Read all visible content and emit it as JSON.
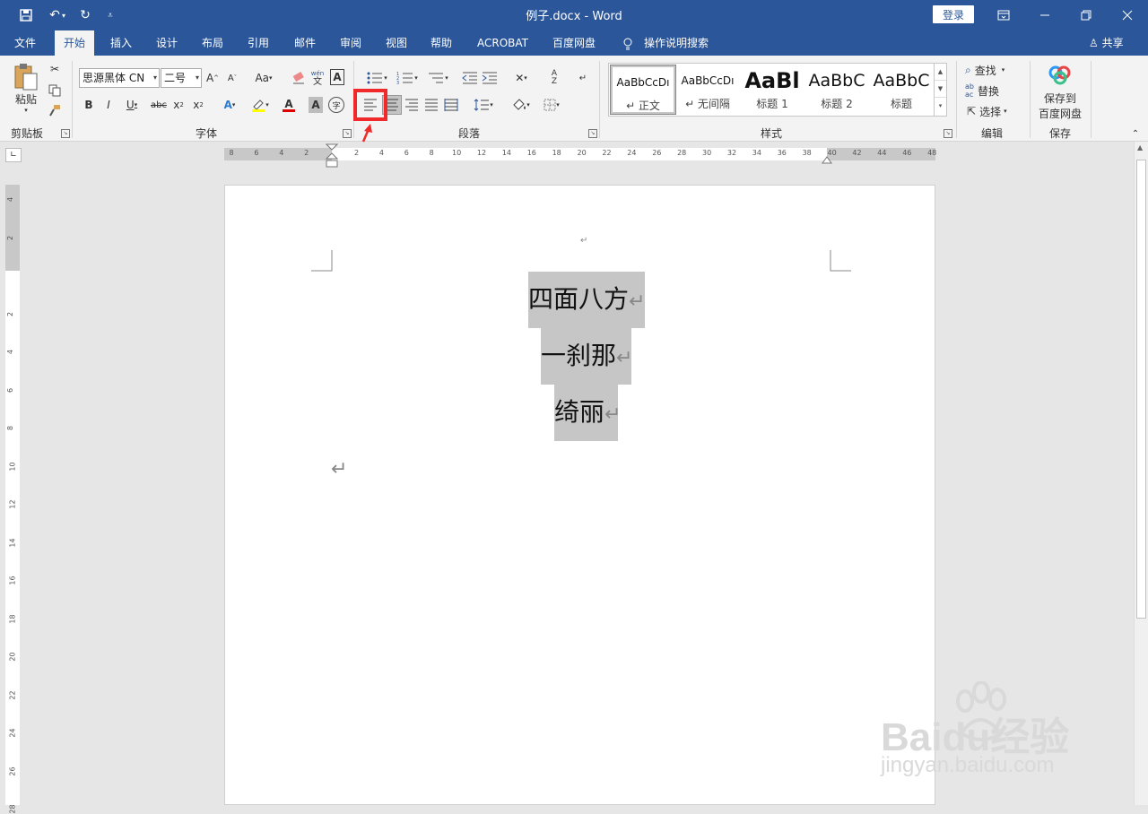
{
  "titlebar": {
    "doc_title": "例子.docx - Word",
    "login": "登录"
  },
  "tabs": [
    "文件",
    "开始",
    "插入",
    "设计",
    "布局",
    "引用",
    "邮件",
    "审阅",
    "视图",
    "帮助",
    "ACROBAT",
    "百度网盘",
    "操作说明搜索"
  ],
  "share": "共享",
  "clipboard": {
    "paste": "粘贴",
    "label": "剪贴板"
  },
  "font": {
    "family": "思源黑体 CN",
    "size": "二号",
    "label": "字体",
    "change_case": "Aa",
    "phonetic": "wén"
  },
  "paragraph": {
    "label": "段落"
  },
  "styles": {
    "label": "样式",
    "items": [
      {
        "preview": "AaBbCcDı",
        "name": "↵ 正文"
      },
      {
        "preview": "AaBbCcDı",
        "name": "↵ 无间隔"
      },
      {
        "preview": "AaBl",
        "name": "标题 1"
      },
      {
        "preview": "AaBbC",
        "name": "标题 2"
      },
      {
        "preview": "AaBbC",
        "name": "标题"
      }
    ]
  },
  "editing": {
    "find": "查找",
    "replace": "替换",
    "select": "选择",
    "label": "编辑"
  },
  "save": {
    "line1": "保存到",
    "line2": "百度网盘",
    "label": "保存"
  },
  "ruler_h": [
    "8",
    "6",
    "4",
    "2",
    "",
    "2",
    "4",
    "6",
    "8",
    "10",
    "12",
    "14",
    "16",
    "18",
    "20",
    "22",
    "24",
    "26",
    "28",
    "30",
    "32",
    "34",
    "36",
    "38",
    "40",
    "42",
    "44",
    "46",
    "48"
  ],
  "ruler_v": [
    "4",
    "2",
    "",
    "2",
    "4",
    "6",
    "8",
    "10",
    "12",
    "14",
    "16",
    "18",
    "20",
    "22",
    "24",
    "26",
    "28"
  ],
  "document": {
    "top_mark": "↵",
    "lines": [
      "四面八方",
      "一刹那",
      "绮丽"
    ],
    "para_mark": "↵"
  },
  "watermark": {
    "brand": "Baidu经验",
    "url": "jingyan.baidu.com"
  }
}
